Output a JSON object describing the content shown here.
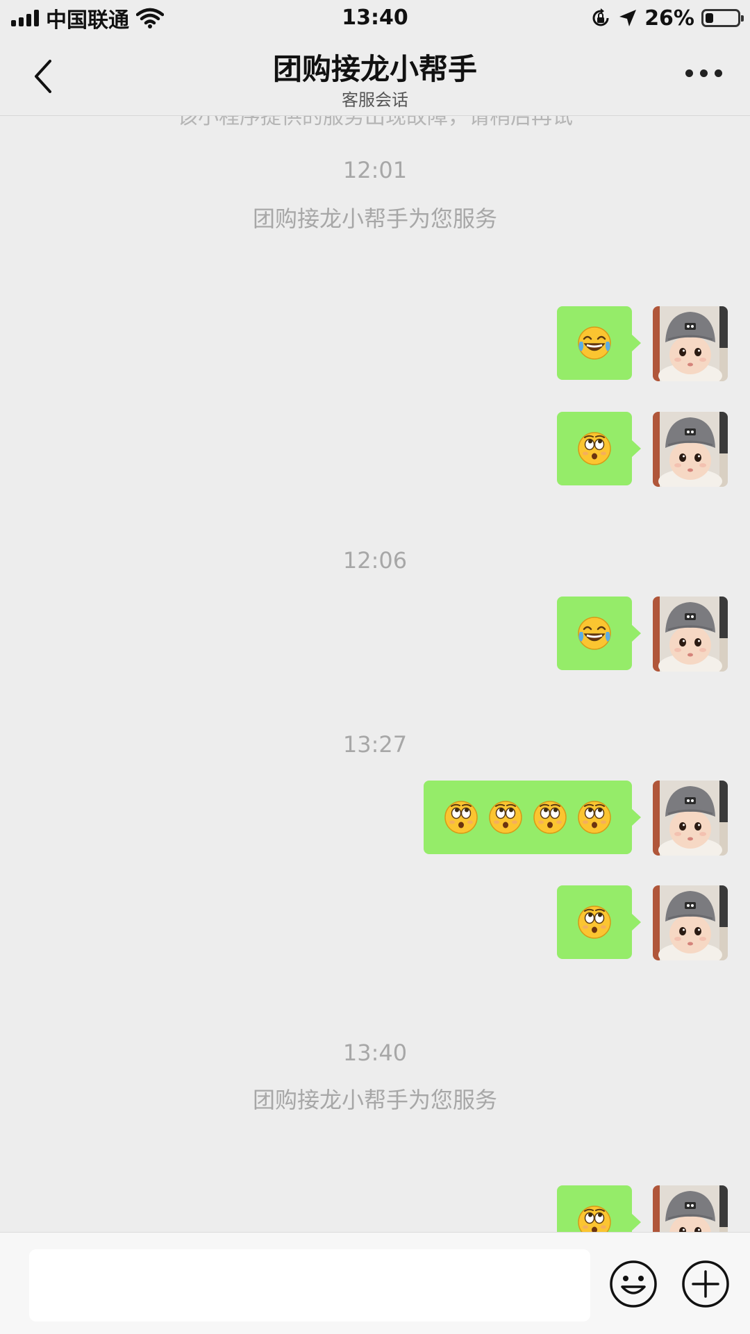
{
  "status_bar": {
    "carrier": "中国联通",
    "time": "13:40",
    "battery_percent": "26%",
    "battery_level": 0.26,
    "icons": [
      "signal-icon",
      "wifi-icon",
      "orientation-lock-icon",
      "location-icon",
      "battery-icon"
    ]
  },
  "nav": {
    "title": "团购接龙小帮手",
    "subtitle": "客服会话",
    "back_icon": "chevron-left-icon",
    "more_icon": "more-dots-icon"
  },
  "chat": {
    "cut_notice": "该小程序提供的服务出现故障，请稍后再试",
    "items": [
      {
        "type": "timestamp",
        "text": "12:01"
      },
      {
        "type": "system",
        "text": "团购接龙小帮手为您服务"
      },
      {
        "type": "message",
        "from": "me",
        "emojis": [
          "laugh-cry-emoji"
        ]
      },
      {
        "type": "message",
        "from": "me",
        "emojis": [
          "eye-roll-emoji"
        ]
      },
      {
        "type": "timestamp",
        "text": "12:06"
      },
      {
        "type": "message",
        "from": "me",
        "emojis": [
          "laugh-cry-emoji"
        ]
      },
      {
        "type": "timestamp",
        "text": "13:27"
      },
      {
        "type": "message",
        "from": "me",
        "emojis": [
          "eye-roll-emoji",
          "eye-roll-emoji",
          "eye-roll-emoji",
          "eye-roll-emoji"
        ]
      },
      {
        "type": "message",
        "from": "me",
        "emojis": [
          "eye-roll-emoji"
        ]
      },
      {
        "type": "timestamp",
        "text": "13:40"
      },
      {
        "type": "system",
        "text": "团购接龙小帮手为您服务"
      },
      {
        "type": "message",
        "from": "me",
        "emojis": [
          "eye-roll-emoji"
        ]
      }
    ]
  },
  "input_bar": {
    "value": "",
    "emoji_button_icon": "smiley-icon",
    "plus_button_icon": "plus-circle-icon"
  },
  "colors": {
    "background": "#ededed",
    "bubble_green": "#95ec69",
    "timestamp_gray": "#a7a7a7"
  }
}
